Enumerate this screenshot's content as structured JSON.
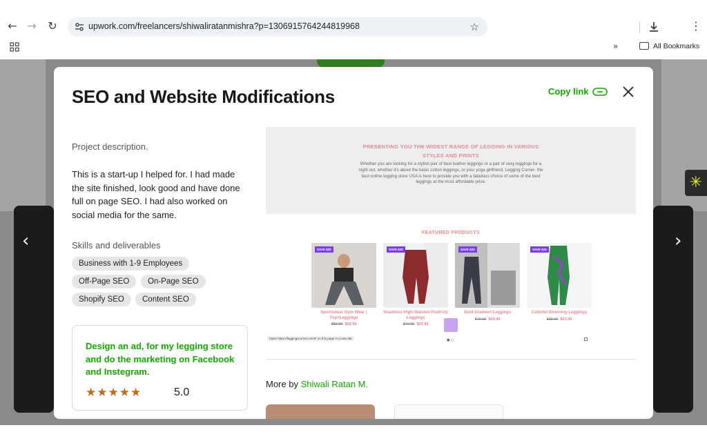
{
  "browser": {
    "url": "upwork.com/freelancers/shiwaliratanmishra?p=1306915764244819968",
    "bookmarks_label": "All Bookmarks"
  },
  "modal": {
    "title": "SEO and Website Modifications",
    "copy_link_label": "Copy link",
    "project_description_label": "Project description.",
    "description": "This is a start-up I helped for. I had made the site finished, look good and have done full on page SEO. I had also worked on social media for the same.",
    "skills_label": "Skills and deliverables",
    "skills": [
      "Business with 1-9 Employees",
      "Off-Page SEO",
      "On-Page SEO",
      "Shopify SEO",
      "Content SEO"
    ],
    "job_card": {
      "title": "Design an ad, for my legging store and do the marketing on Facebook and Instegram.",
      "stars": "★★★★★",
      "rating": "5.0"
    },
    "more_by_prefix": "More by ",
    "more_by_name": "Shiwali Ratan M."
  },
  "project_image": {
    "heading_line1": "PRESENTING YOU THE WIDEST RANGE OF LEGGING IN VARIOUS",
    "heading_line2": "STYLES AND PRINTS",
    "body": "Whether you are looking for a stylish pair of faux leather leggings or a pair of sexy leggings for a night out, whether it's about the basic cotton leggings, or your yoga girlfriend, Legging Corner- the best online legging store USA is here to provide you with a fabulous choice of some of the best leggings at the most affordable price.",
    "featured_label": "FEATURED PRODUCTS",
    "products": [
      {
        "save": "SAVE $20",
        "name": "Sportswear Gym Wear | Top+Leggings",
        "old_price": "$59.99",
        "new_price": "$39.99",
        "color": "#8a8f8c"
      },
      {
        "save": "SAVE $20",
        "name": "Seamless High-Waisted Push Up Leggings",
        "old_price": "$49.99",
        "new_price": "$29.99",
        "color": "#8c2b2e"
      },
      {
        "save": "SAVE $20",
        "name": "Gold Gradient Leggings",
        "old_price": "$49.99",
        "new_price": "$29.99",
        "color": "#6c6f78"
      },
      {
        "save": "SAVE $16",
        "name": "Colorful Slimming Leggings",
        "old_price": "$39.99",
        "new_price": "$23.99",
        "color": "#2f8a4a"
      }
    ],
    "tooltip": "Open https://leggingscorner.com/# on this page in a new tab"
  },
  "colors": {
    "accent_green": "#14a800",
    "star_orange": "#c66b1b",
    "sale_purple": "#7b3fe4"
  }
}
